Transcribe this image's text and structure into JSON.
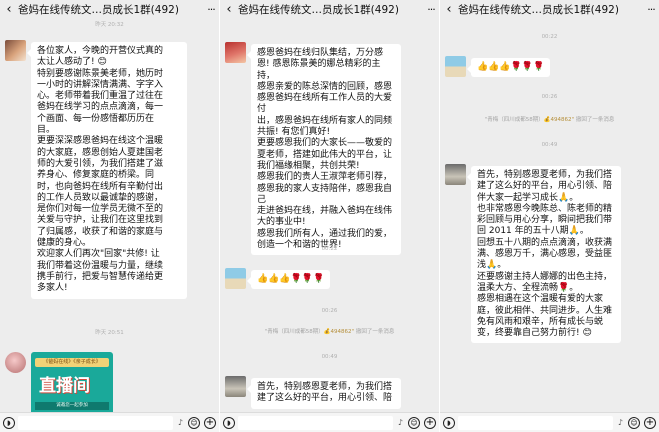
{
  "common": {
    "back": "‹",
    "more": "···",
    "voice": "◗",
    "mic": "♪",
    "emoji": "☺",
    "plus": "+"
  },
  "panels": [
    {
      "title": "爸妈在线传统文…员成长1群(492)",
      "time1": "昨天 20:32",
      "msg1": "各位家人，今晚的开营仪式真的\n太让人感动了! 😊\n特别要感谢陈景美老师，她历时\n一小时的讲解深情满满、字字入\n心。老师带着我们重温了过往在\n爸妈在线学习的点点滴滴，每一\n个画面、每一份感悟都历历在\n目。\n更要深深感恩爸妈在线这个温暖\n的大家庭，感恩创始人夏建国老\n师的大爱引领，为我们搭建了滋\n养身心、修复家庭的桥梁。同\n时，也向爸妈在线所有辛勤付出\n的工作人员致以最诚挚的感谢，\n是你们对每一位学员无微不至的\n关爱与守护，让我们在这里找到\n了归属感，收获了和谐的家庭与\n健康的身心。\n欢迎家人们再次\"回家\"共修! 让\n我们带着这份温暖与力量，继续\n携手前行，把爱与智慧传递给更\n多家人!",
      "time2": "昨天 20:51",
      "card_banner": "《爸妈在线》《亲子成长》",
      "card_title": "直播间",
      "card_sub": "诚邀您一起参加"
    },
    {
      "title": "爸妈在线传统文…员成长1群(492)",
      "msg1": "感恩爸妈在线归队集结，万分感\n恩! 感恩陈景美的娜总精彩的主持，\n感恩亲爱的陈总深情的回顾，感恩\n感恩爸妈在线所有工作人员的大爱付\n出，感恩爸妈在线所有家人的同频\n共振! 有您们真好!\n更要感恩我们的大家长——敬爱的\n夏老师，搭建如此伟大的平台，让\n我们福缘相聚，共创共荣!\n感恩我们的贵人王淑萍老师引荐，\n感恩我的家人支持陪伴，感恩我自己\n走进爸妈在线，并融入爸妈在线伟\n大的事业中!\n感恩我们所有人，通过我们的爱，\n创造一个和谐的世界!",
      "time1": "00:22",
      "msg2": "👍👍👍🌹🌹🌹",
      "time2": "00:26",
      "sys_who": "\"青梅（四川成都58期）",
      "sys_amt": "💰494862\"",
      "sys_tail": " 撤回了一条消息",
      "time3": "00:49",
      "msg3": "首先，特别感恩夏老师，为我们搭\n建了这么好的平台，用心引领、陪"
    },
    {
      "title": "爸妈在线传统文…员成长1群(492)",
      "time1": "00:22",
      "msg1": "👍👍👍🌹🌹🌹",
      "time2": "00:26",
      "sys_who": "\"青梅（四川成都58期）",
      "sys_amt": "💰494862\"",
      "sys_tail": " 撤回了一条消息",
      "time3": "00:49",
      "msg2": "首先，特别感恩夏老师，为我们搭\n建了这么好的平台，用心引领、陪\n伴大家一起学习成长🙏。\n也非常感恩今晚陈总、陈老师的精\n彩回顾与用心分享，瞬间把我们带\n回 2011 年的五十八期🙏。\n回想五十八期的点点滴滴，收获满\n满、感恩万千，满心感恩，受益匪\n浅🙏。\n还要感谢主持人娜娜的出色主持，\n温柔大方、全程流畅🌹。\n感恩相遇在这个温暖有爱的大家\n庭，彼此相伴、共同进步。人生难\n免有风雨和艰辛，所有成长与蜕\n变，终要靠自己努力前行! 😊"
    }
  ],
  "colors": {
    "bg": "#ededed",
    "bubble": "#ffffff",
    "accent": "#b58f3a"
  }
}
